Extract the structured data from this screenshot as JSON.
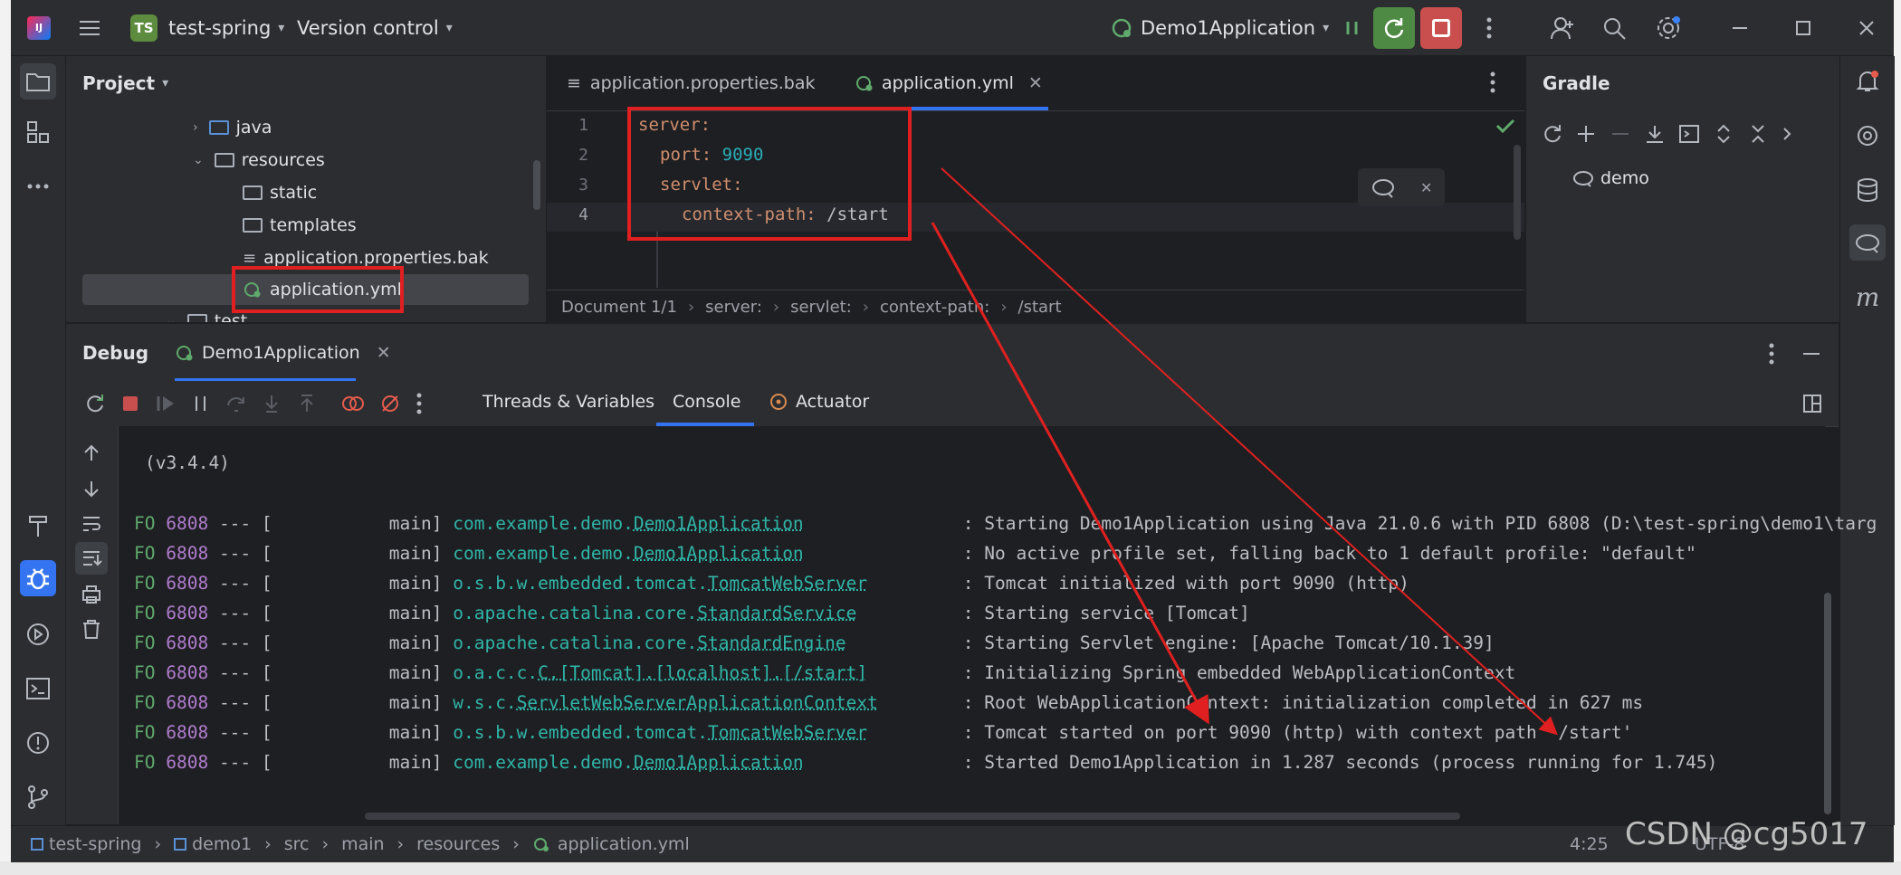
{
  "titlebar": {
    "project_badge": "TS",
    "project_name": "test-spring",
    "vcs": "Version control",
    "run_config": "Demo1Application"
  },
  "project_panel": {
    "title": "Project",
    "items": [
      "java",
      "resources",
      "static",
      "templates",
      "application.properties.bak",
      "application.yml",
      "test"
    ]
  },
  "editor": {
    "tabs": [
      "application.properties.bak",
      "application.yml"
    ],
    "line_numbers": [
      "1",
      "2",
      "3",
      "4"
    ],
    "code": {
      "l1_key": "server:",
      "l2_key": "port:",
      "l2_val": "9090",
      "l3_key": "servlet:",
      "l4_key": "context-path:",
      "l4_val": "/start"
    },
    "breadcrumb": [
      "Document 1/1",
      "server:",
      "servlet:",
      "context-path:",
      "/start"
    ]
  },
  "gradle": {
    "title": "Gradle",
    "root": "demo"
  },
  "debug": {
    "label": "Debug",
    "session_tab": "Demo1Application",
    "subtabs": [
      "Threads & Variables",
      "Console",
      "Actuator"
    ],
    "version": "(v3.4.4)",
    "log_prefix": "FO",
    "pid": "6808",
    "sep": "--- [",
    "thread": "main]",
    "logs": [
      {
        "pkg": "com.example.demo.",
        "cls": "Demo1Application",
        "msg": ": Starting Demo1Application using Java 21.0.6 with PID 6808 (D:\\test-spring\\demo1\\targ"
      },
      {
        "pkg": "com.example.demo.",
        "cls": "Demo1Application",
        "msg": ": No active profile set, falling back to 1 default profile: \"default\""
      },
      {
        "pkg": "o.s.b.w.embedded.tomcat.",
        "cls": "TomcatWebServer",
        "msg": ": Tomcat initialized with port 9090 (http)"
      },
      {
        "pkg": "o.apache.catalina.core.",
        "cls": "StandardService",
        "msg": ": Starting service [Tomcat]"
      },
      {
        "pkg": "o.apache.catalina.core.",
        "cls": "StandardEngine",
        "msg": ": Starting Servlet engine: [Apache Tomcat/10.1.39]"
      },
      {
        "pkg": "o.a.c.c.",
        "cls": "C.[Tomcat].[localhost].[/start]",
        "msg": ": Initializing Spring embedded WebApplicationContext"
      },
      {
        "pkg": "w.s.c.",
        "cls": "ServletWebServerApplicationContext",
        "msg": ": Root WebApplicationContext: initialization completed in 627 ms"
      },
      {
        "pkg": "o.s.b.w.embedded.tomcat.",
        "cls": "TomcatWebServer",
        "msg": ": Tomcat started on port 9090 (http) with context path '/start'"
      },
      {
        "pkg": "com.example.demo.",
        "cls": "Demo1Application",
        "msg": ": Started Demo1Application in 1.287 seconds (process running for 1.745)"
      }
    ]
  },
  "statusbar": {
    "path": [
      "test-spring",
      "demo1",
      "src",
      "main",
      "resources",
      "application.yml"
    ],
    "position": "4:25",
    "encoding": "UTF-8"
  },
  "watermark": "CSDN @cg5017"
}
